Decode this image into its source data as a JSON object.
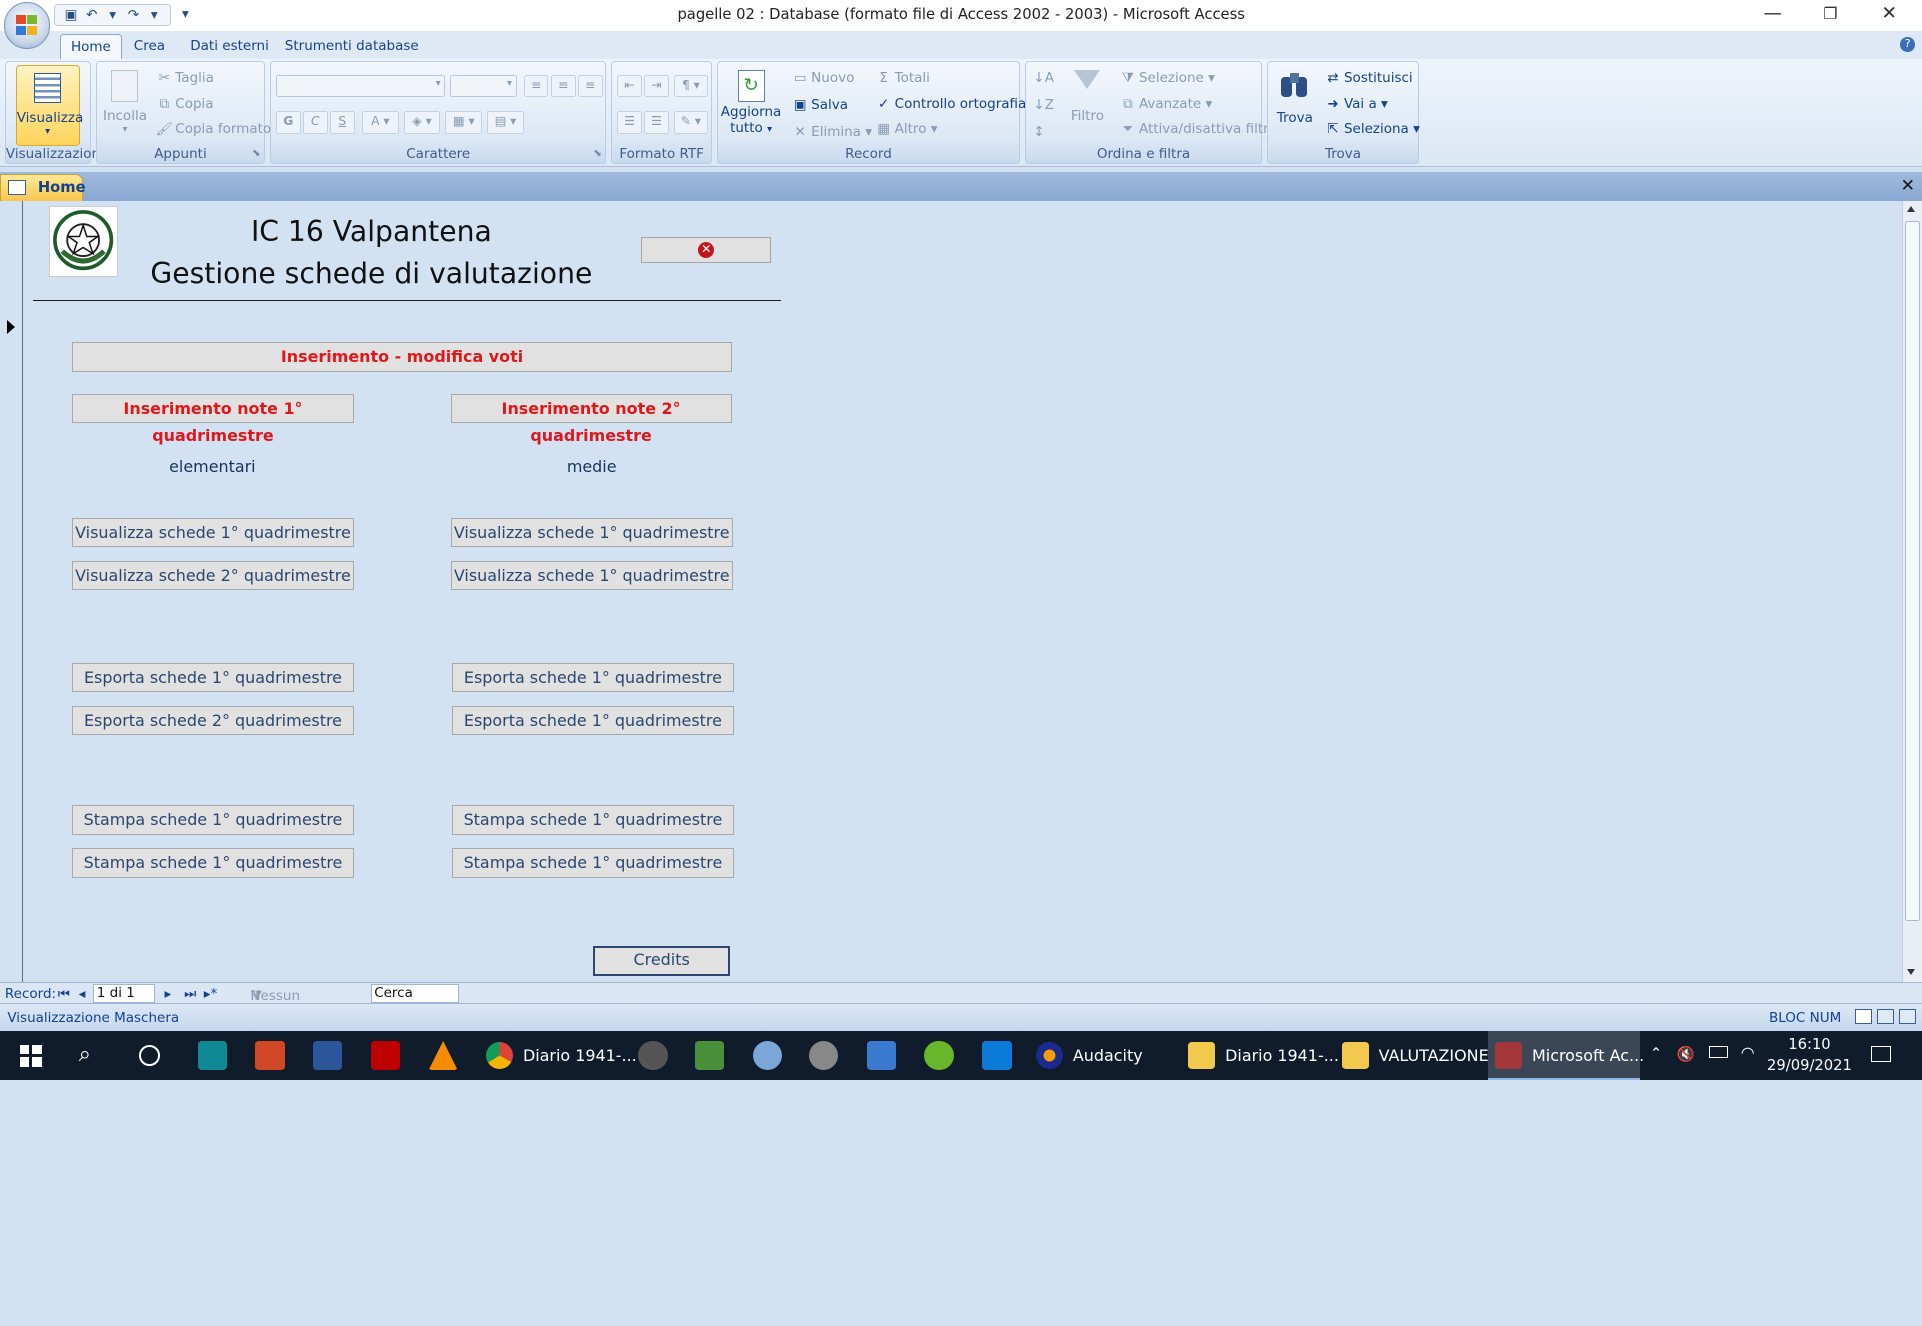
{
  "window": {
    "title": "pagelle 02 : Database (formato file di Access 2002 - 2003) - Microsoft Access",
    "minimize": "—",
    "restore": "❐",
    "close": "✕"
  },
  "ribbon_tabs": [
    "Home",
    "Crea",
    "Dati esterni",
    "Strumenti database"
  ],
  "ribbon": {
    "views": {
      "button": "Visualizza",
      "label": "Visualizzazioni"
    },
    "clipboard": {
      "paste": "Incolla",
      "cut": "Taglia",
      "copy": "Copia",
      "format_painter": "Copia formato",
      "label": "Appunti"
    },
    "font": {
      "label": "Carattere",
      "bold": "G",
      "italic": "C",
      "underline": "S"
    },
    "rtf": {
      "label": "Formato RTF"
    },
    "records": {
      "refresh": "Aggiorna tutto",
      "refresh_l1": "Aggiorna",
      "refresh_l2": "tutto",
      "new": "Nuovo",
      "save": "Salva",
      "delete": "Elimina",
      "totals": "Totali",
      "spelling": "Controllo ortografia",
      "more": "Altro",
      "label": "Record"
    },
    "sort_filter": {
      "filter": "Filtro",
      "selection": "Selezione",
      "advanced": "Avanzate",
      "toggle_filter": "Attiva/disattiva filtro",
      "label": "Ordina e filtra"
    },
    "find": {
      "find": "Trova",
      "replace": "Sostituisci",
      "goto": "Vai a",
      "select": "Seleziona",
      "label": "Trova"
    }
  },
  "doc_tab": {
    "label": "Home"
  },
  "form": {
    "title_line1": "IC 16 Valpantena",
    "title_line2": "Gestione schede di valutazione",
    "main_button": "Inserimento - modifica voti",
    "notes_q1": "Inserimento note 1° quadrimestre",
    "notes_q2": "Inserimento note 2° quadrimestre",
    "col_left_label": "elementari",
    "col_right_label": "medie",
    "left": {
      "view_q1": "Visualizza schede 1° quadrimestre",
      "view_q2": "Visualizza schede 2° quadrimestre",
      "export_q1": "Esporta schede 1° quadrimestre",
      "export_q2": "Esporta schede 2° quadrimestre",
      "print_q1": "Stampa schede 1° quadrimestre",
      "print_q2": "Stampa schede 1° quadrimestre"
    },
    "right": {
      "view_q1": "Visualizza schede 1° quadrimestre",
      "view_q2": "Visualizza schede 1° quadrimestre",
      "export_q1": "Esporta schede 1° quadrimestre",
      "export_q2": "Esporta schede 1° quadrimestre",
      "print_q1": "Stampa schede 1° quadrimestre",
      "print_q2": "Stampa schede 1° quadrimestre"
    },
    "credits": "Credits"
  },
  "record_nav": {
    "label": "Record:",
    "position": "1 di 1",
    "filter": "Nessun filtro",
    "search": "Cerca"
  },
  "status": {
    "left": "Visualizzazione Maschera",
    "right": "BLOC NUM"
  },
  "taskbar": {
    "apps": [
      {
        "label": "Diario 1941-..."
      },
      {
        "label": "Audacity"
      },
      {
        "label": "Diario 1941-..."
      },
      {
        "label": "VALUTAZIONE"
      },
      {
        "label": "Microsoft Ac..."
      }
    ],
    "time": "16:10",
    "date": "29/09/2021"
  }
}
